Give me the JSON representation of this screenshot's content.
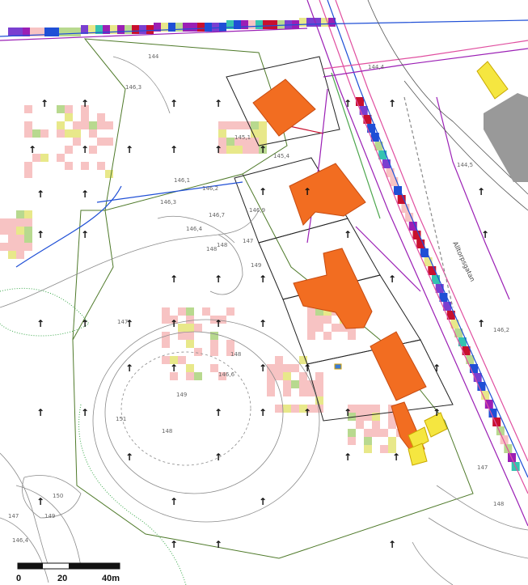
{
  "map": {
    "colors": {
      "building": "#f26d21",
      "building_yellow": "#f5e640",
      "grey_block": "#999999",
      "pipe_purple": "#9b1fb5",
      "pipe_blue": "#1f4fd6",
      "pipe_green": "#4da64d",
      "pipe_pink": "#e04fa0",
      "contour": "#7a7a7a",
      "boundary": "#4f7a2a",
      "cell_pink": "#f7c3c3",
      "cell_yellow": "#e8e88a",
      "cell_green": "#b8d98f"
    },
    "street_name": "Alltorpsgatan",
    "contour_labels": [
      "144",
      "146,3",
      "145,1",
      "145,4",
      "146,1",
      "146,2",
      "146,3",
      "146,7",
      "146,9",
      "146,4",
      "144,5",
      "144,4",
      "146,2",
      "148",
      "148",
      "147",
      "149",
      "147",
      "148",
      "146,6",
      "149",
      "148",
      "151",
      "150",
      "149",
      "147",
      "146,4",
      "147",
      "148"
    ],
    "scale": {
      "labels": [
        "0",
        "20",
        "40m"
      ]
    },
    "icons": [
      "north-arrow-icon"
    ]
  }
}
